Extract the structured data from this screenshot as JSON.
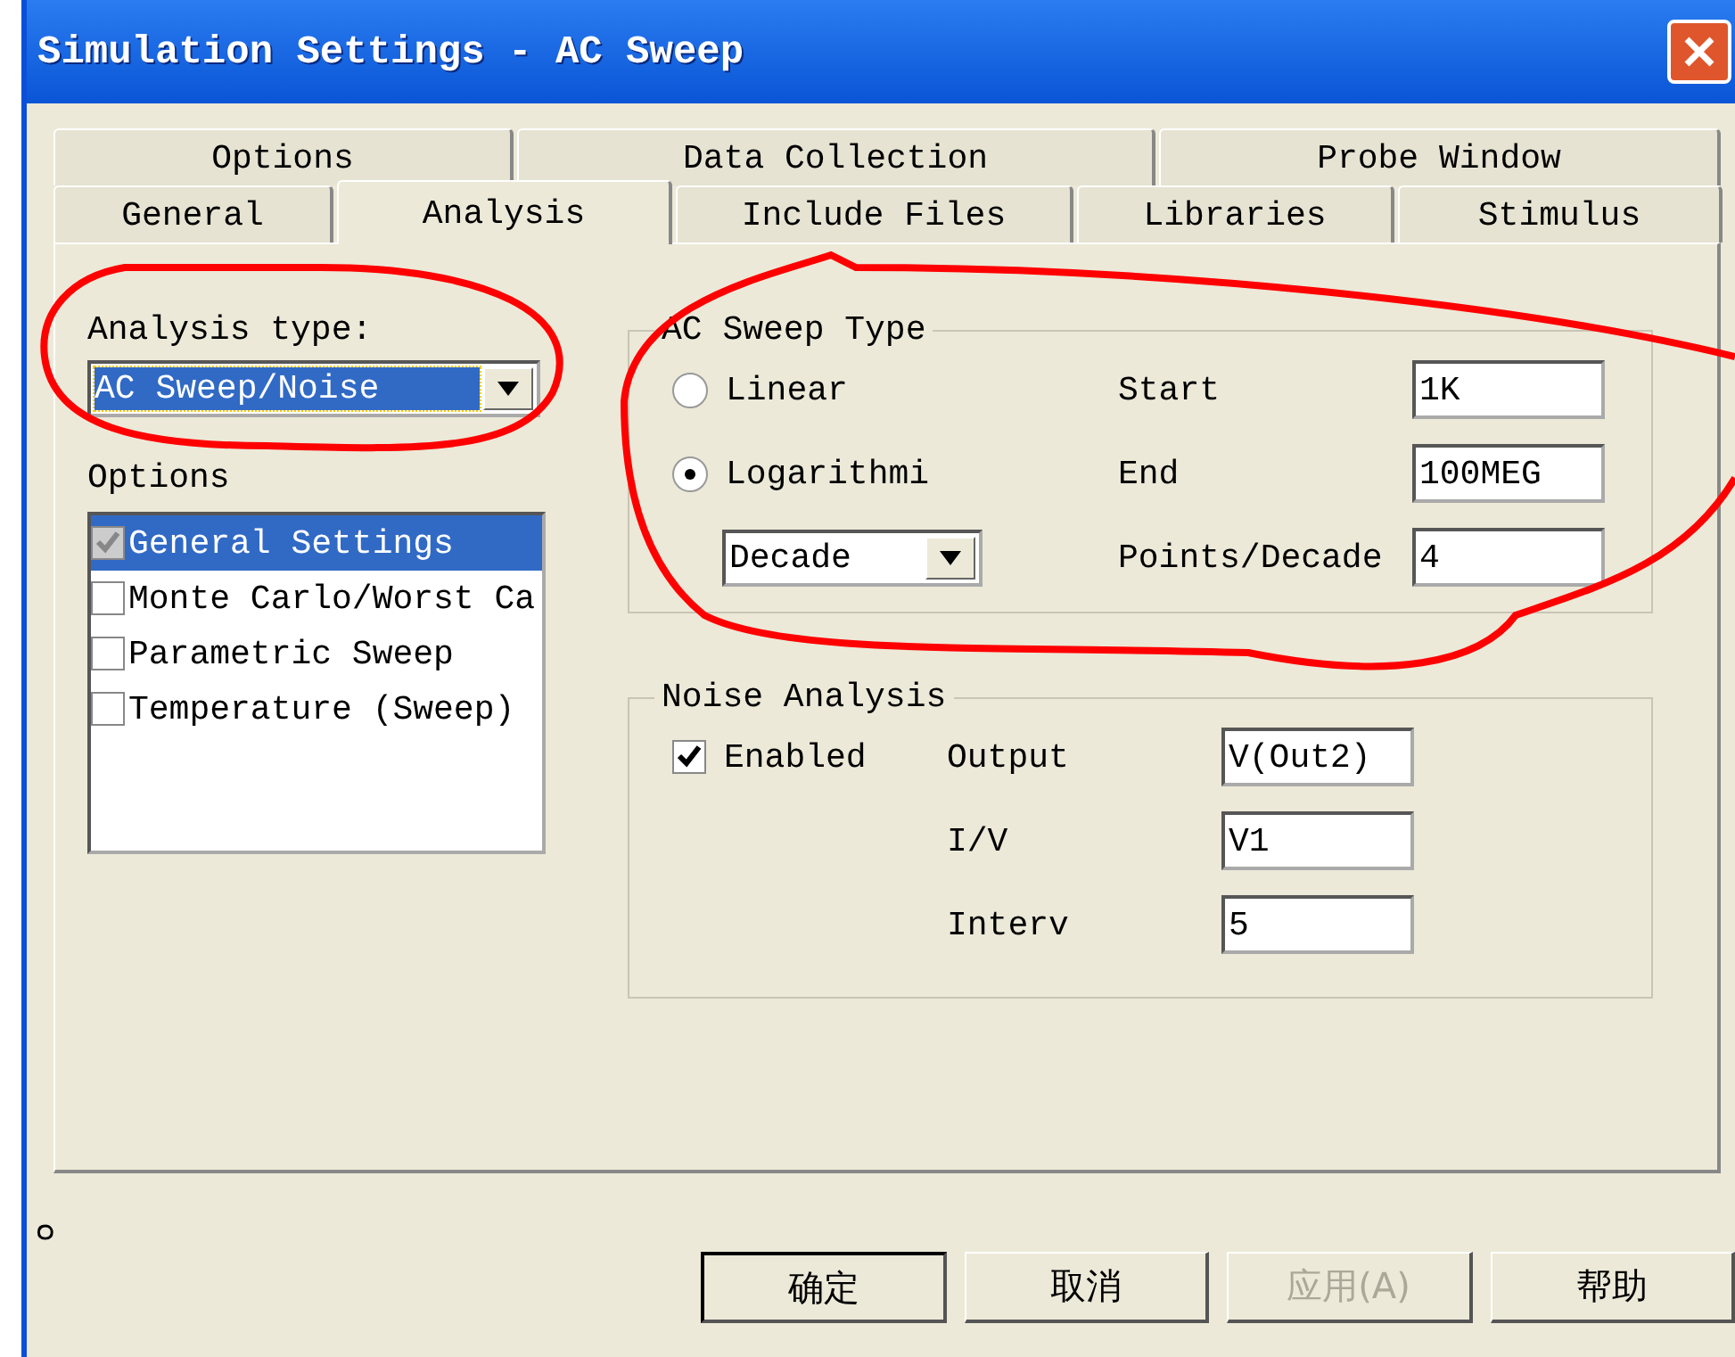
{
  "window": {
    "title": "Simulation Settings - AC Sweep"
  },
  "tabs_back": [
    {
      "label": "Options",
      "selected": false
    },
    {
      "label": "Data Collection",
      "selected": false
    },
    {
      "label": "Probe Window",
      "selected": false
    }
  ],
  "tabs_front": [
    {
      "label": "General",
      "selected": false
    },
    {
      "label": "Analysis",
      "selected": true
    },
    {
      "label": "Include Files",
      "selected": false
    },
    {
      "label": "Libraries",
      "selected": false
    },
    {
      "label": "Stimulus",
      "selected": false
    }
  ],
  "analysis_type": {
    "label": "Analysis type:",
    "value": "AC Sweep/Noise"
  },
  "options": {
    "label": "Options",
    "items": [
      {
        "label": "General Settings",
        "checked": true,
        "selected": true
      },
      {
        "label": "Monte Carlo/Worst Ca",
        "checked": false,
        "selected": false
      },
      {
        "label": "Parametric Sweep",
        "checked": false,
        "selected": false
      },
      {
        "label": "Temperature (Sweep)",
        "checked": false,
        "selected": false
      }
    ]
  },
  "ac_sweep": {
    "title": "AC Sweep Type",
    "modes": [
      {
        "label": "Linear",
        "selected": false
      },
      {
        "label": "Logarithmi",
        "selected": true
      }
    ],
    "scale": "Decade",
    "fields": [
      {
        "label": "Start",
        "value": "1K"
      },
      {
        "label": "End",
        "value": "100MEG"
      },
      {
        "label": "Points/Decade",
        "value": "4"
      }
    ]
  },
  "noise": {
    "title": "Noise Analysis",
    "enabled": {
      "label": "Enabled",
      "checked": true
    },
    "fields": [
      {
        "label": "Output",
        "value": "V(Out2)"
      },
      {
        "label": "I/V",
        "value": "V1"
      },
      {
        "label": "Interv",
        "value": "5"
      }
    ]
  },
  "buttons": [
    {
      "label": "确定",
      "default": true,
      "disabled": false
    },
    {
      "label": "取消",
      "default": false,
      "disabled": false
    },
    {
      "label": "应用(A)",
      "default": false,
      "disabled": true
    },
    {
      "label": "帮助",
      "default": false,
      "disabled": false
    }
  ],
  "overlay_texts": [
    "。"
  ]
}
